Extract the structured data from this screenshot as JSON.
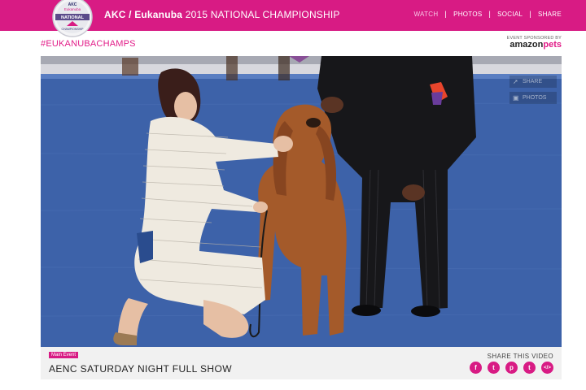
{
  "header": {
    "logo_top": "AKC",
    "logo_mid": "Eukanuba",
    "logo_ribbon": "NATIONAL",
    "logo_bottom": "CHAMPIONSHIP",
    "title_bold": "AKC / Eukanuba",
    "title_rest": "2015 NATIONAL CHAMPIONSHIP",
    "nav": [
      {
        "label": "WATCH",
        "active": true
      },
      {
        "label": "PHOTOS",
        "active": false
      },
      {
        "label": "SOCIAL",
        "active": false
      },
      {
        "label": "SHARE",
        "active": false
      }
    ],
    "separator": "|"
  },
  "hashtag": "#EUKANUBACHAMPS",
  "sponsor": {
    "caption": "EVENT SPONSORED BY",
    "brand": "amazon",
    "brand_suffix": "pets"
  },
  "player": {
    "share_button": "SHARE",
    "photo_button": "PHOTOS"
  },
  "video": {
    "badge": "Main Event",
    "title": "AENC SATURDAY NIGHT FULL SHOW",
    "share_label": "SHARE THIS VIDEO",
    "share_icons": [
      {
        "name": "facebook-icon",
        "glyph": "f"
      },
      {
        "name": "twitter-icon",
        "glyph": "t"
      },
      {
        "name": "pinterest-icon",
        "glyph": "p"
      },
      {
        "name": "tumblr-icon",
        "glyph": "t"
      },
      {
        "name": "embed-icon",
        "glyph": "</>"
      }
    ]
  },
  "colors": {
    "brand_pink": "#d81b84",
    "accent_pink": "#e21c88",
    "carpet_blue": "#3f63a8"
  }
}
